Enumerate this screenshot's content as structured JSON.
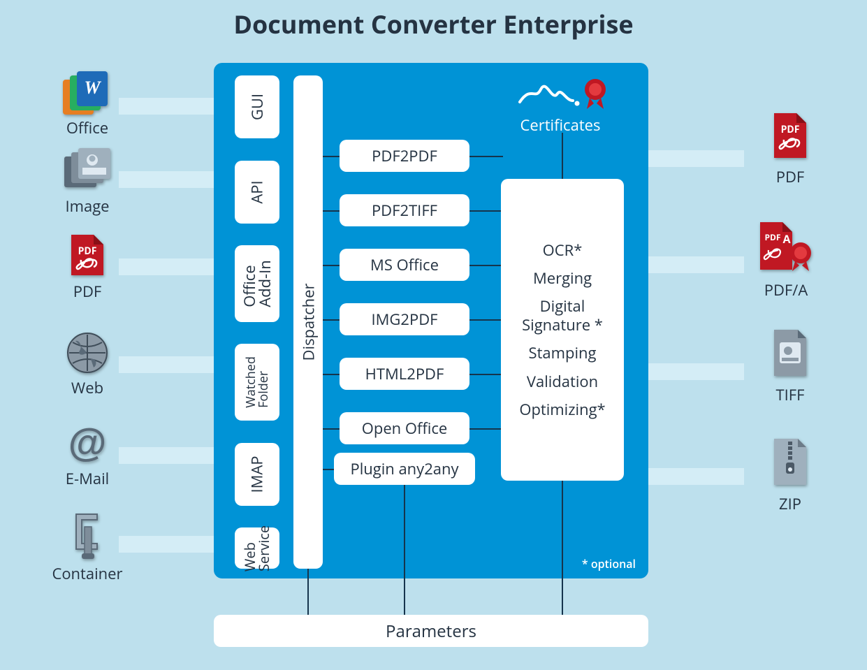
{
  "title": "Document Converter Enterprise",
  "inputs": [
    {
      "label": "Office"
    },
    {
      "label": "Image"
    },
    {
      "label": "PDF"
    },
    {
      "label": "Web"
    },
    {
      "label": "E-Mail"
    },
    {
      "label": "Container"
    }
  ],
  "interfaces": {
    "gui": "GUI",
    "api": "API",
    "addin_line1": "Office",
    "addin_line2": "Add-In",
    "wfolder_line1": "Watched",
    "wfolder_line2": "Folder",
    "imap": "IMAP",
    "websvc_line1": "Web",
    "websvc_line2": "Service"
  },
  "dispatcher": "Dispatcher",
  "converters": [
    "PDF2PDF",
    "PDF2TIFF",
    "MS Office",
    "IMG2PDF",
    "HTML2PDF",
    "Open Office",
    "Plugin any2any"
  ],
  "processing": [
    "OCR*",
    "Merging",
    "Digital Signature *",
    "Stamping",
    "Validation",
    "Optimizing*"
  ],
  "certificates": "Certificates",
  "optional_note": "* optional",
  "outputs": [
    {
      "label": "PDF"
    },
    {
      "label": "PDF/A"
    },
    {
      "label": "TIFF"
    },
    {
      "label": "ZIP"
    }
  ],
  "parameters": "Parameters",
  "colors": {
    "page_bg": "#bde0ed",
    "panel_bg": "#0093d6",
    "box_bg": "#ffffff",
    "connector": "#d4edf6",
    "pdf_red": "#c01823"
  }
}
